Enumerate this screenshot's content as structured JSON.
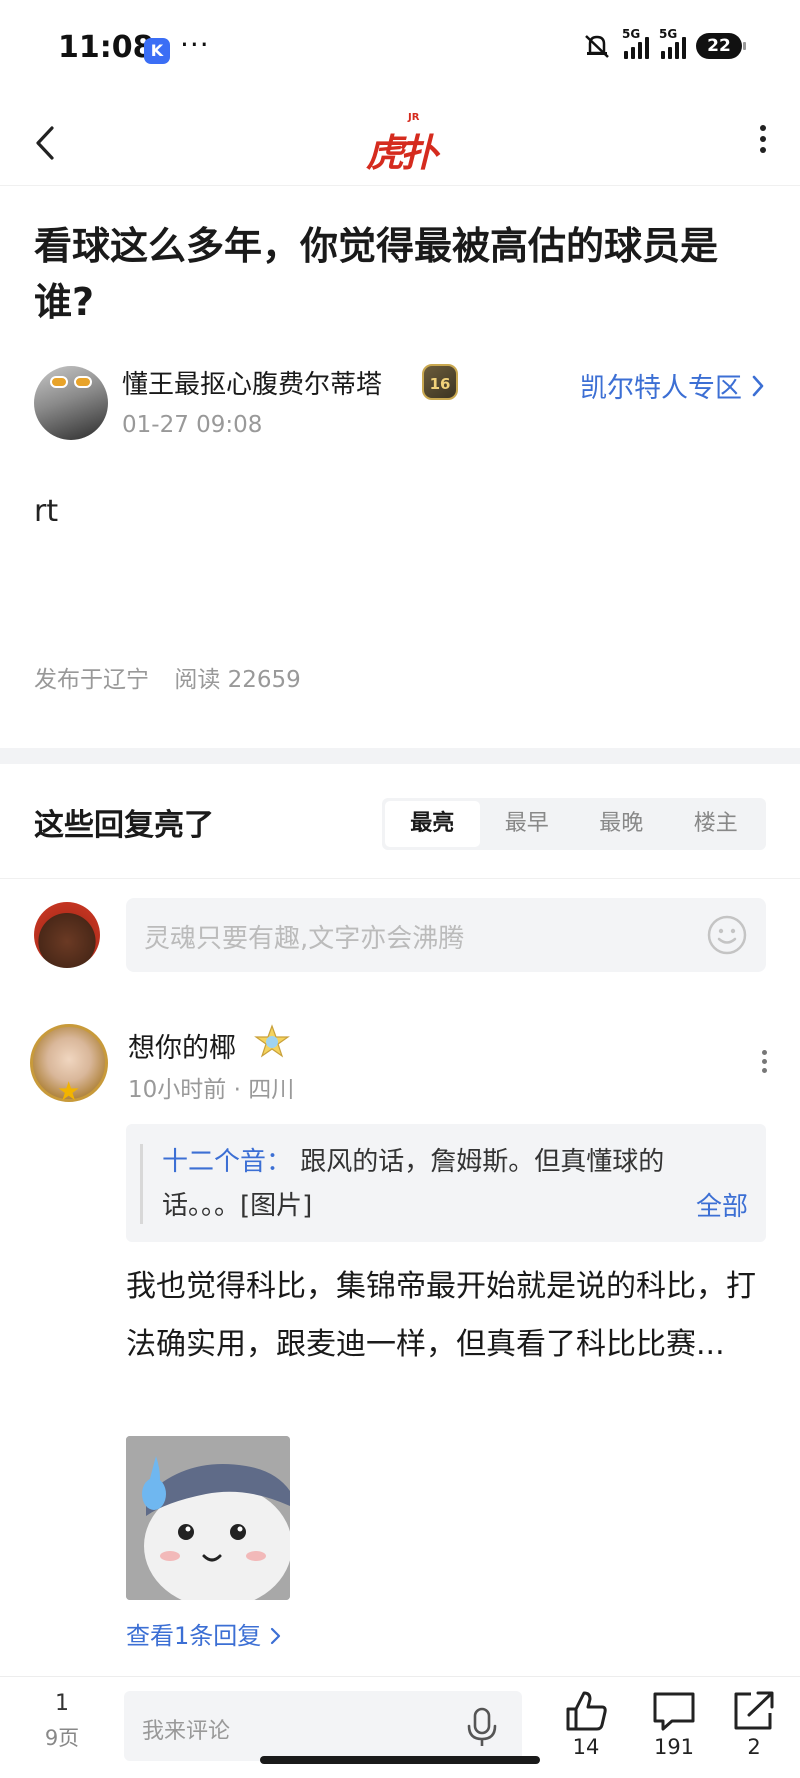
{
  "status_bar": {
    "time": "11:08",
    "app_icon_letter": "K",
    "more": "···",
    "network_1": "5G",
    "network_2": "5G",
    "battery": "22"
  },
  "header": {
    "logo_text": "虎扑",
    "logo_sup": "JR"
  },
  "post": {
    "title": "看球这么多年，你觉得最被高估的球员是谁?",
    "author": "懂王最抠心腹费尔蒂塔",
    "author_level": "16",
    "time": "01-27 09:08",
    "zone_link": "凯尔特人专区",
    "body": "rt",
    "location": "发布于辽宁",
    "reads": "阅读 22659"
  },
  "replies_section": {
    "title": "这些回复亮了",
    "sort_tabs": [
      "最亮",
      "最早",
      "最晚",
      "楼主"
    ],
    "active_tab": "最亮",
    "comment_placeholder": "灵魂只要有趣,文字亦会沸腾"
  },
  "reply": {
    "user": "想你的椰",
    "time_location": "10小时前 · 四川",
    "quote_user": "十二个音：",
    "quote_text": "跟风的话，詹姆斯。但真懂球的话。。。[图片]",
    "quote_expand": "全部",
    "text": "我也觉得科比，集锦帝最开始就是说的科比，打法确实用，跟麦迪一样，但真看了科比比赛...",
    "view_replies": "查看1条回复"
  },
  "bottom_bar": {
    "page_current": "1",
    "page_total": "9页",
    "input_placeholder": "我来评论",
    "likes": "14",
    "comments": "191",
    "shares": "2"
  },
  "colors": {
    "brand_red": "#d52b1e",
    "link_blue": "#3c6fd4",
    "muted": "#999999",
    "band": "#f2f3f5"
  },
  "icons": [
    "back-icon",
    "more-vertical-icon",
    "chevron-right-icon",
    "emoji-icon",
    "mic-icon",
    "like-icon",
    "comment-icon",
    "share-icon"
  ]
}
